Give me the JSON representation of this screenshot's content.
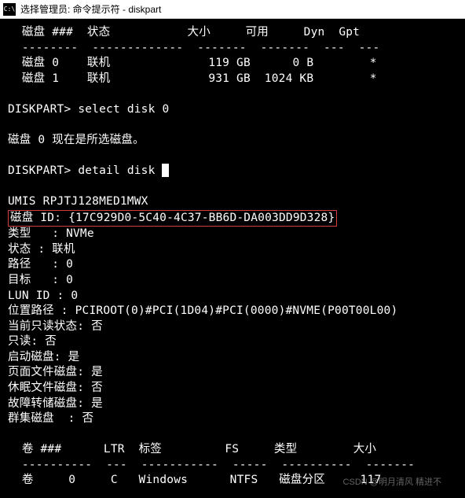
{
  "window": {
    "icon_label": "C:\\",
    "title": "选择管理员: 命令提示符 - diskpart"
  },
  "disk_table": {
    "headers": {
      "disk_num": "磁盘 ###",
      "status": "状态",
      "size": "大小",
      "free": "可用",
      "dyn": "Dyn",
      "gpt": "Gpt"
    },
    "divider1": "--------",
    "divider2": "-------------",
    "divider3": "-------",
    "divider4": "-------",
    "divider5": "---",
    "divider6": "---",
    "rows": [
      {
        "disk": "磁盘 0",
        "status": "联机",
        "size": "119 GB",
        "free": "0 B",
        "dyn": "",
        "gpt": "*"
      },
      {
        "disk": "磁盘 1",
        "status": "联机",
        "size": "931 GB",
        "free": "1024 KB",
        "dyn": "",
        "gpt": "*"
      }
    ]
  },
  "prompt1": {
    "prefix": "DISKPART>",
    "command": "select disk 0"
  },
  "response1": "磁盘 0 现在是所选磁盘。",
  "prompt2": {
    "prefix": "DISKPART>",
    "command": "detail disk"
  },
  "detail": {
    "model": "UMIS RPJTJ128MED1MWX",
    "disk_id_label": "磁盘 ID:",
    "disk_id_value": "{17C929D0-5C40-4C37-BB6D-DA003DD9D328}",
    "type_label": "类型",
    "type_value": "NVMe",
    "status_label": "状态",
    "status_value": "联机",
    "path_label": "路径",
    "path_value": "0",
    "target_label": "目标",
    "target_value": "0",
    "lunid_label": "LUN ID",
    "lunid_value": "0",
    "locpath_label": "位置路径",
    "locpath_value": "PCIROOT(0)#PCI(1D04)#PCI(0000)#NVME(P00T00L00)",
    "readonly_cur_label": "当前只读状态:",
    "readonly_cur_value": "否",
    "readonly_label": "只读:",
    "readonly_value": "否",
    "bootdisk_label": "启动磁盘:",
    "bootdisk_value": "是",
    "pagefile_label": "页面文件磁盘:",
    "pagefile_value": "是",
    "hibernate_label": "休眠文件磁盘:",
    "hibernate_value": "否",
    "crashdump_label": "故障转储磁盘:",
    "crashdump_value": "是",
    "cluster_label": "群集磁盘",
    "cluster_value": "否"
  },
  "vol_table": {
    "headers": {
      "vol": "卷 ###",
      "ltr": "LTR",
      "label": "标签",
      "fs": "FS",
      "type": "类型",
      "size": "大小"
    },
    "div1": "----------",
    "div2": "---",
    "div3": "-----------",
    "div4": "-----",
    "div5": "----------",
    "div6": "-------",
    "rows": [
      {
        "vol": "卷     0",
        "ltr": "C",
        "label": "Windows",
        "fs": "NTFS",
        "type": "磁盘分区",
        "size": "117"
      }
    ]
  },
  "watermark": "CSDN @明月清风 精进不"
}
